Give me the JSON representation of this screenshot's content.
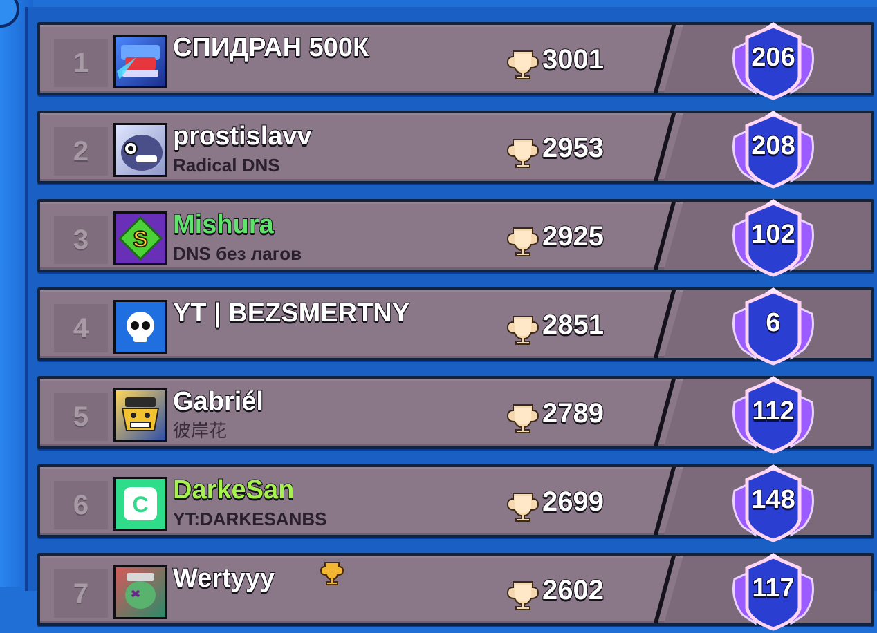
{
  "colors": {
    "background_blue": "#1f6fd6",
    "row_fill": "#8a7787",
    "name_green": "#5fe36a",
    "name_lime": "#a6f04f",
    "badge_blue": "#2a3fd1"
  },
  "leaderboard": {
    "rows": [
      {
        "rank": "1",
        "name": "СПИДРАН 500К",
        "club": "",
        "trophies": "3001",
        "badge": "206",
        "name_color": "white",
        "avatar": "championship-icon"
      },
      {
        "rank": "2",
        "name": "prostislavv",
        "club": "Radical DNS",
        "trophies": "2953",
        "badge": "208",
        "name_color": "white",
        "avatar": "brawler-portrait-icon"
      },
      {
        "rank": "3",
        "name": "Mishura",
        "club": "DNS без лагов",
        "trophies": "2925",
        "badge": "102",
        "name_color": "green",
        "avatar": "green-gem-icon"
      },
      {
        "rank": "4",
        "name": "YT | BEZSMERTNY",
        "club": "",
        "trophies": "2851",
        "badge": "6",
        "name_color": "white",
        "avatar": "skull-icon"
      },
      {
        "rank": "5",
        "name": "Gabriél",
        "club": "彼岸花",
        "trophies": "2789",
        "badge": "112",
        "name_color": "white",
        "avatar": "robot-portrait-icon"
      },
      {
        "rank": "6",
        "name": "DarkeSan",
        "club": "YT:DARKESANBS",
        "trophies": "2699",
        "badge": "148",
        "name_color": "lime",
        "avatar": "green-c-icon"
      },
      {
        "rank": "7",
        "name": "Wertyyy",
        "club": "",
        "trophies": "2602",
        "badge": "117",
        "name_color": "white",
        "avatar": "zombie-portrait-icon"
      }
    ]
  }
}
